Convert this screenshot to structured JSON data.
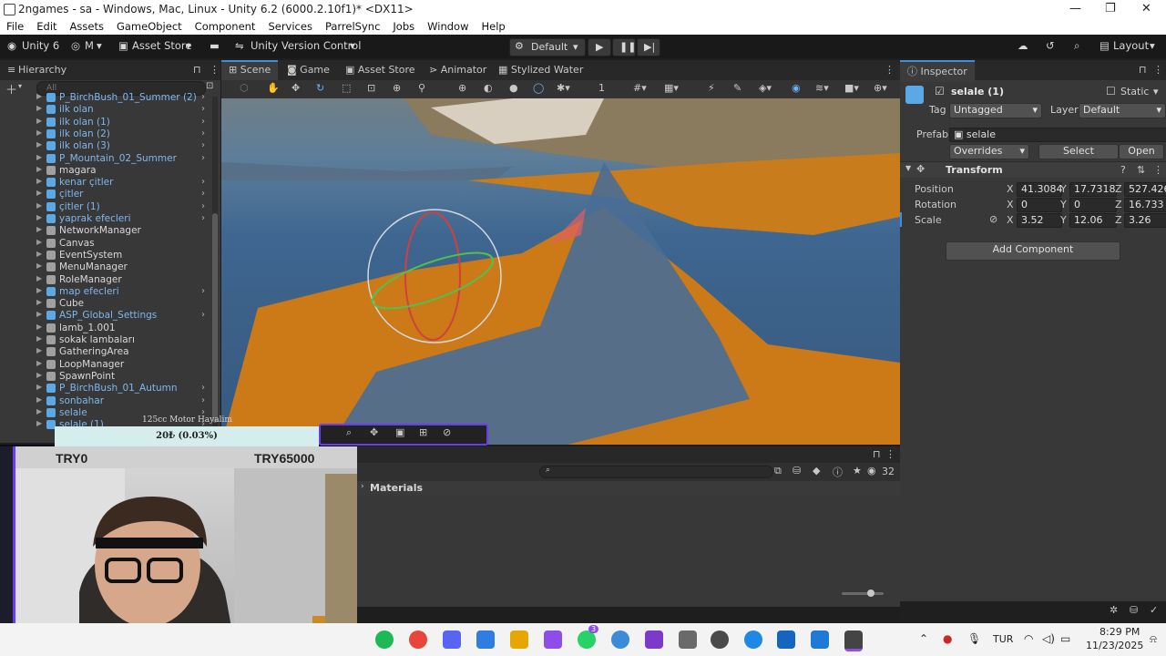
{
  "window": {
    "title": "2ngames - sa - Windows, Mac, Linux - Unity 6.2 (6000.2.10f1)* <DX11>",
    "minimize": "—",
    "maximize": "❐",
    "close": "✕"
  },
  "menubar": [
    "File",
    "Edit",
    "Assets",
    "GameObject",
    "Component",
    "Services",
    "ParrelSync",
    "Jobs",
    "Window",
    "Help"
  ],
  "toolbar": {
    "unity_label": "Unity 6",
    "account_label": "M",
    "asset_store_label": "Asset Store",
    "version_control_label": "Unity Version Control",
    "layout_profile": "Default",
    "layout_label": "Layout"
  },
  "hierarchy": {
    "tab_label": "Hierarchy",
    "search_placeholder": "All",
    "items": [
      {
        "label": "P_BirchBush_01_Summer (2)",
        "prefab": true
      },
      {
        "label": "ilk olan",
        "prefab": true
      },
      {
        "label": "ilk olan (1)",
        "prefab": true
      },
      {
        "label": "ilk olan (2)",
        "prefab": true
      },
      {
        "label": "ilk olan (3)",
        "prefab": true
      },
      {
        "label": "P_Mountain_02_Summer",
        "prefab": true
      },
      {
        "label": "magara",
        "prefab": false
      },
      {
        "label": "kenar çitler",
        "prefab": true
      },
      {
        "label": "çitler",
        "prefab": true
      },
      {
        "label": "çitler (1)",
        "prefab": true
      },
      {
        "label": "yaprak efecleri",
        "prefab": true
      },
      {
        "label": "NetworkManager",
        "prefab": false
      },
      {
        "label": "Canvas",
        "prefab": false
      },
      {
        "label": "EventSystem",
        "prefab": false
      },
      {
        "label": "MenuManager",
        "prefab": false
      },
      {
        "label": "RoleManager",
        "prefab": false
      },
      {
        "label": "map efecleri",
        "prefab": true
      },
      {
        "label": "Cube",
        "prefab": false
      },
      {
        "label": "ASP_Global_Settings",
        "prefab": true
      },
      {
        "label": "lamb_1.001",
        "prefab": false
      },
      {
        "label": "sokak lambaları",
        "prefab": false
      },
      {
        "label": "GatheringArea",
        "prefab": false
      },
      {
        "label": "LoopManager",
        "prefab": false
      },
      {
        "label": "SpawnPoint",
        "prefab": false
      },
      {
        "label": "P_BirchBush_01_Autumn",
        "prefab": true
      },
      {
        "label": "sonbahar",
        "prefab": true
      },
      {
        "label": "selale",
        "prefab": true
      },
      {
        "label": "selale (1)",
        "prefab": true
      }
    ]
  },
  "scene_tabs": [
    "Scene",
    "Game",
    "Asset Store",
    "Animator",
    "Stylized Water"
  ],
  "scene_toolbar": {
    "grid_value": "1"
  },
  "inspector": {
    "tab_label": "Inspector",
    "object_name": "selale (1)",
    "static_label": "Static",
    "tag_label": "Tag",
    "tag_value": "Untagged",
    "layer_label": "Layer",
    "layer_value": "Default",
    "prefab_label": "Prefab",
    "prefab_value": "selale",
    "overrides_label": "Overrides",
    "select_label": "Select",
    "open_label": "Open",
    "transform_label": "Transform",
    "position_label": "Position",
    "rotation_label": "Rotation",
    "scale_label": "Scale",
    "position": {
      "x": "41.3084",
      "y": "17.7318",
      "z": "527.426"
    },
    "rotation": {
      "x": "0",
      "y": "0",
      "z": "16.733"
    },
    "scale": {
      "x": "3.52",
      "y": "12.06",
      "z": "3.26"
    },
    "axis_x": "X",
    "axis_y": "Y",
    "axis_z": "Z",
    "add_component_label": "Add Component"
  },
  "project_panel": {
    "materials_label": "Materials",
    "count_label": "32"
  },
  "stream_overlay": {
    "goal_title": "125cc Motor Hayalim",
    "goal_progress": "20₺ (0.03%)",
    "left_amount": "TRY0",
    "right_amount": "TRY65000"
  },
  "taskbar": {
    "lang": "TUR",
    "time": "8:29 PM",
    "date": "11/23/2025",
    "whatsapp_badge": "3"
  },
  "colors": {
    "accent": "#3d8fde",
    "prefab_text": "#7eb7ee",
    "overlay_purple": "#6a3cf0"
  }
}
